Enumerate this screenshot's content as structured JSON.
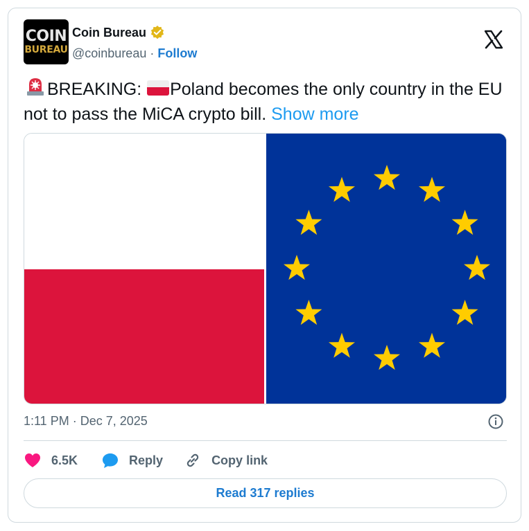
{
  "author": {
    "avatar_line1": "COIN",
    "avatar_line2": "BUREAU",
    "display_name": "Coin Bureau",
    "handle": "@coinbureau",
    "separator": "·",
    "follow_label": "Follow",
    "verified_color": "#e2b719"
  },
  "tweet": {
    "text_breaking": "BREAKING: ",
    "text_main": "Poland becomes the only country in the EU not to pass the MiCA crypto bill. ",
    "show_more": "Show more",
    "timestamp": "1:11 PM · Dec 7, 2025"
  },
  "media": {
    "left_image": "poland-flag",
    "right_image": "eu-flag",
    "colors": {
      "poland_red": "#dc143c",
      "eu_blue": "#003399",
      "eu_star": "#ffcc00"
    }
  },
  "actions": {
    "like_count": "6.5K",
    "reply_label": "Reply",
    "copy_link_label": "Copy link",
    "like_color": "#f91880",
    "accent": "#1d9bf0"
  },
  "footer": {
    "read_replies_label": "Read 317 replies"
  }
}
